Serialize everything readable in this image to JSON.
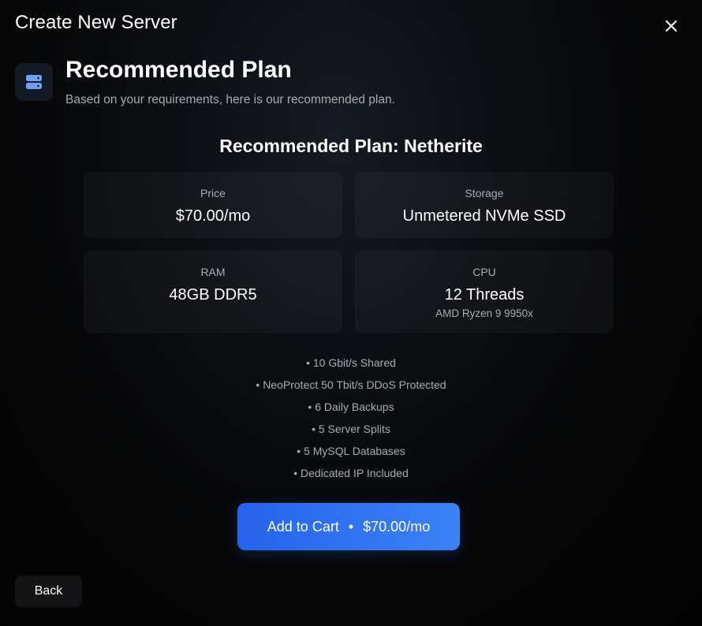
{
  "modal": {
    "title": "Create New Server",
    "close_icon": "close-icon"
  },
  "header": {
    "icon": "server-icon",
    "title": "Recommended Plan",
    "subtitle": "Based on your requirements, here is our recommended plan."
  },
  "plan": {
    "heading": "Recommended Plan: Netherite",
    "specs": {
      "price": {
        "label": "Price",
        "value": "$70.00/mo"
      },
      "storage": {
        "label": "Storage",
        "value": "Unmetered NVMe SSD"
      },
      "ram": {
        "label": "RAM",
        "value": "48GB DDR5"
      },
      "cpu": {
        "label": "CPU",
        "value": "12 Threads",
        "detail": "AMD Ryzen 9 9950x"
      }
    },
    "features": [
      "10 Gbit/s Shared",
      "NeoProtect 50 Tbit/s DDoS Protected",
      "6 Daily Backups",
      "5 Server Splits",
      "5 MySQL Databases",
      "Dedicated IP Included"
    ]
  },
  "actions": {
    "add_to_cart_label": "Add to Cart",
    "separator": "•",
    "add_to_cart_price": "$70.00/mo",
    "back_label": "Back"
  },
  "colors": {
    "background": "#030303",
    "accent": "#3b82f6",
    "accent_dark": "#2563eb",
    "muted_text": "#a8adb5"
  }
}
